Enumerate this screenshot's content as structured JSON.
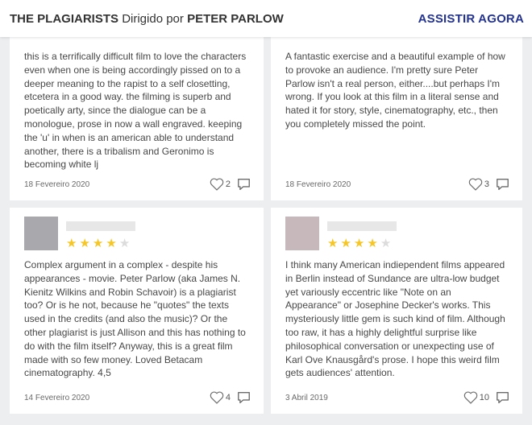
{
  "header": {
    "film_title": "THE PLAGIARISTS",
    "directed_by": "Dirigido por",
    "director": "PETER PARLOW",
    "cta_label": "ASSISTIR AGORA"
  },
  "colors": {
    "accent": "#24348f",
    "star_filled": "#f6c626",
    "star_empty": "#dcdcdc"
  },
  "reviews": [
    {
      "text": "this is a terrifically difficult film to love the characters even when one is being accordingly pissed on to a deeper meaning to the rapist to a self closetting, etcetera in a good way. the filming is superb and poetically arty, since the dialogue can be a monologue, prose in now a wall engraved. keeping the 'u' in when is an american able to understand another, there is a tribalism and Geronimo is becoming white lj",
      "date": "18 Fevereiro 2020",
      "likes": "2"
    },
    {
      "text": "A fantastic exercise and a beautiful example of how to provoke an audience. I'm pretty sure Peter Parlow isn't a real person, either....but perhaps I'm wrong. If you look at this film in a literal sense and hated it for story, style, cinematography, etc., then you completely missed the point.",
      "date": "18 Fevereiro 2020",
      "likes": "3"
    },
    {
      "avatar_color": "#a9a9ad",
      "rating": 4,
      "max_rating": 5,
      "text": "Complex argument in a complex - despite his appearances - movie. Peter Parlow (aka James N. Kienitz Wilkins and Robin Schavoir) is a plagiarist too? Or is he not, because he \"quotes\" the texts used in the credits (and also the music)? Or the other plagiarist is just Allison and this has nothing to do with the film itself? Anyway, this is a great film made with so few money. Loved Betacam cinematography. 4,5",
      "date": "14 Fevereiro 2020",
      "likes": "4"
    },
    {
      "avatar_color": "#c7b9bb",
      "rating": 4,
      "max_rating": 5,
      "text": "I think many American indiependent films appeared in Berlin instead of Sundance are ultra-low budget yet variously eccentric like \"Note on an Appearance\" or Josephine Decker's works. This mysteriously little gem is such kind of film. Although too raw, it has a highly delightful surprise like philosophical conversation or unexpecting use of Karl Ove Knausgård's prose. I hope this weird film gets audiences' attention.",
      "date": "3 Abril 2019",
      "likes": "10"
    }
  ]
}
